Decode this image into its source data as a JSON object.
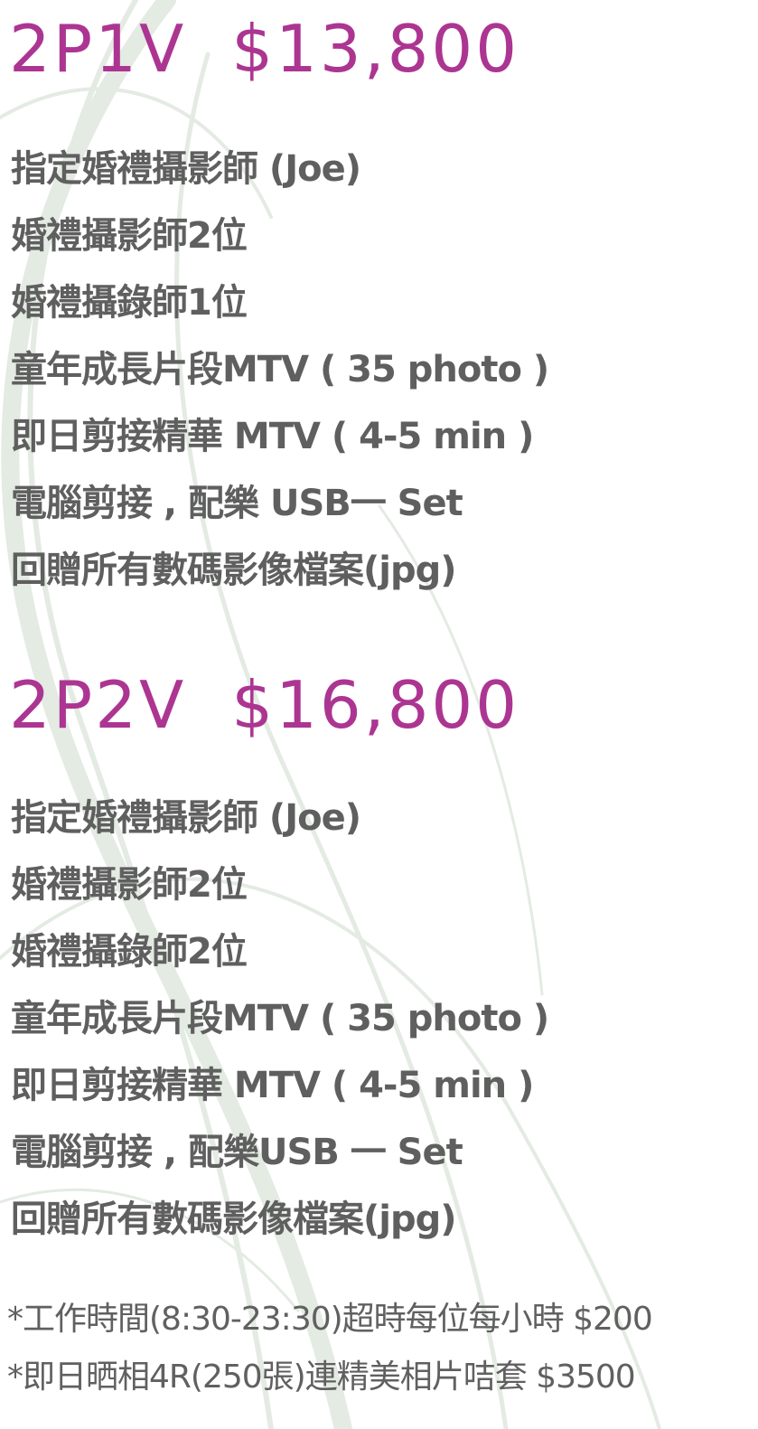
{
  "packages": [
    {
      "name": "2P1V",
      "price": "$13,800",
      "items": [
        "指定婚禮攝影師 (Joe)",
        "婚禮攝影師2位",
        "婚禮攝錄師1位",
        "童年成長片段MTV ( 35 photo )",
        "即日剪接精華 MTV ( 4-5 min )",
        "電腦剪接 , 配樂 USB一 Set",
        "回贈所有數碼影像檔案(jpg)"
      ]
    },
    {
      "name": "2P2V",
      "price": "$16,800",
      "items": [
        "指定婚禮攝影師 (Joe)",
        "婚禮攝影師2位",
        "婚禮攝錄師2位",
        "童年成長片段MTV ( 35 photo )",
        "即日剪接精華 MTV ( 4-5 min )",
        "電腦剪接 , 配樂USB 一 Set",
        "回贈所有數碼影像檔案(jpg)"
      ]
    }
  ],
  "notes": [
    "*工作時間(8:30-23:30)超時每位每小時 $200",
    "*即日晒相4R(250張)連精美相片咭套 $3500"
  ],
  "colors": {
    "title": "#ac3592",
    "body_text": "#5f5f5f",
    "swirl": "#dfe7df"
  }
}
